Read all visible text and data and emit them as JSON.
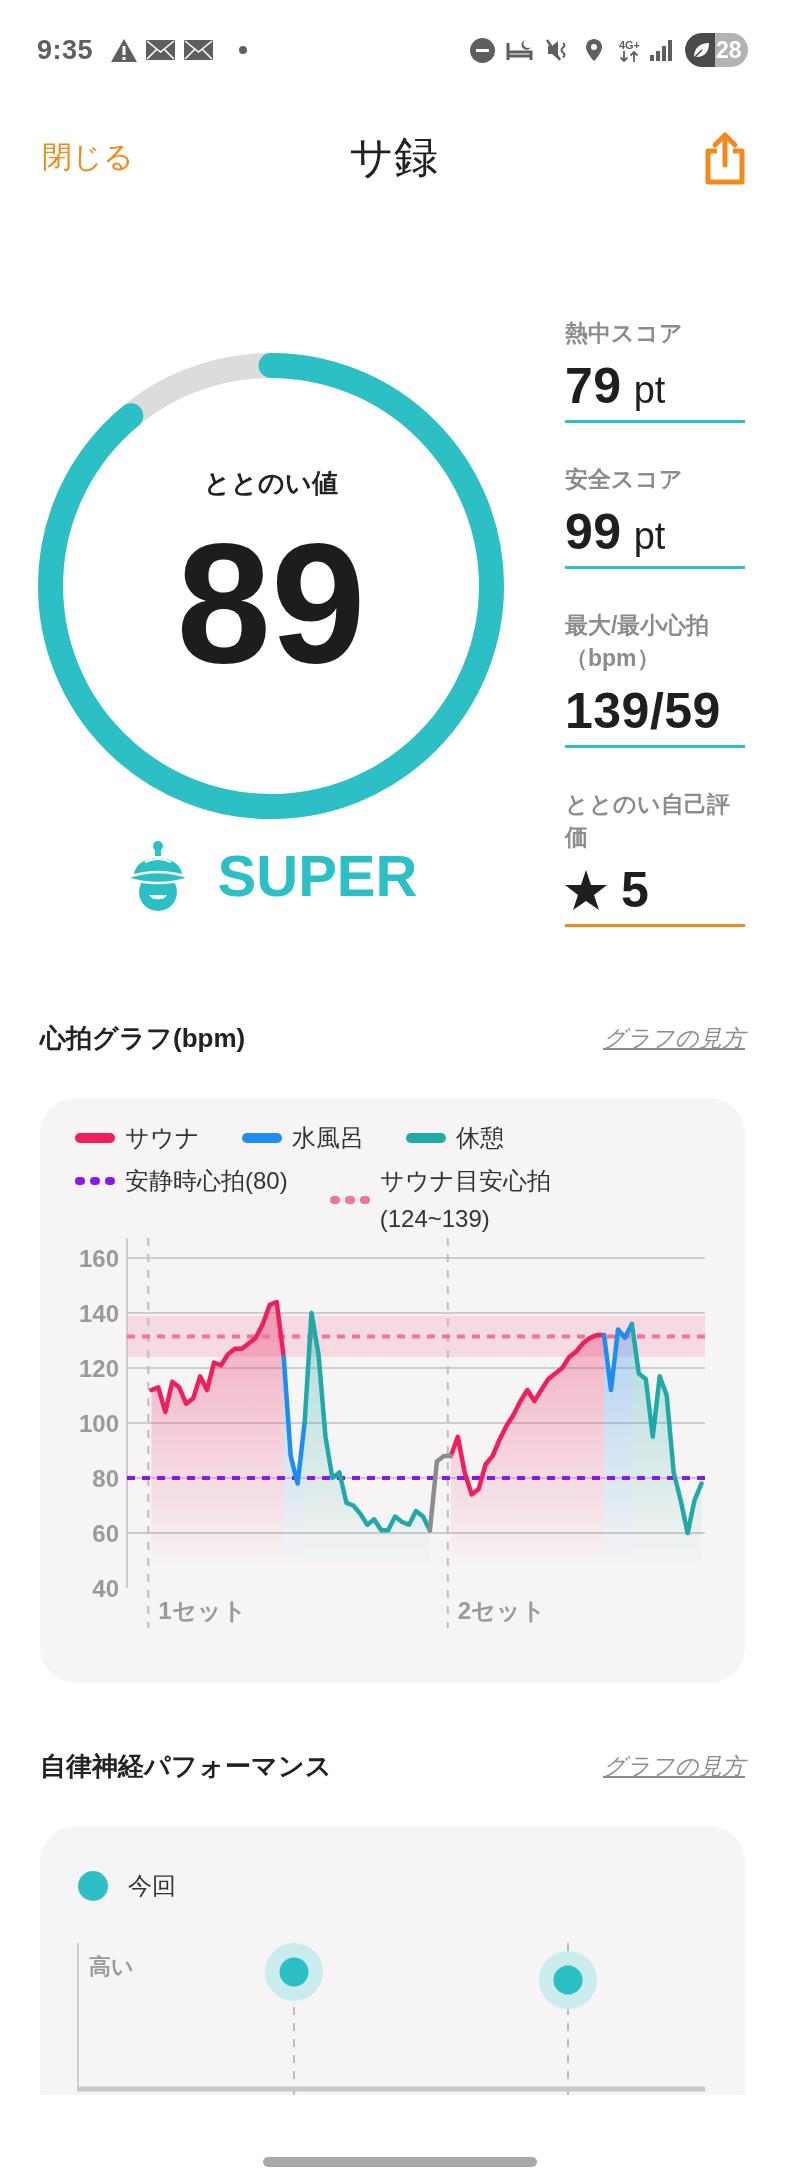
{
  "status_bar": {
    "time": "9:35",
    "network": "4G+",
    "battery": "28"
  },
  "header": {
    "close": "閉じる",
    "title": "サ録"
  },
  "ring": {
    "label": "ととのい値",
    "value": "89",
    "level": 0.89
  },
  "rank": {
    "label": "SUPER"
  },
  "scores": [
    {
      "kind": "score",
      "label": "熱中スコア",
      "value": "79",
      "unit": "pt"
    },
    {
      "kind": "score",
      "label": "安全スコア",
      "value": "99",
      "unit": "pt"
    },
    {
      "kind": "score",
      "label": "最大/最小心拍（bpm）",
      "value": "139/59"
    },
    {
      "kind": "rating",
      "label": "ととのい自己評価",
      "value": "5"
    }
  ],
  "heart_chart": {
    "title": "心拍グラフ(bpm)",
    "help_link": "グラフの見方",
    "set_labels": [
      "1セット",
      "2セット"
    ],
    "chart_data": {
      "type": "area",
      "legend": "top",
      "grid": true,
      "ylim": [
        40,
        160
      ],
      "yticks": [
        40,
        60,
        80,
        100,
        120,
        140,
        160
      ],
      "series": [
        {
          "name": "サウナ",
          "color": "#ee1f5b",
          "values": [
            null,
            null,
            null,
            112,
            113,
            104,
            115,
            113,
            107,
            109,
            117,
            112,
            122,
            121,
            125,
            127,
            127,
            129,
            131,
            136,
            143,
            144,
            124,
            null,
            null,
            null,
            null,
            null,
            null,
            null,
            null,
            null,
            null,
            null,
            null,
            null,
            null,
            null,
            null,
            null,
            null,
            null,
            null,
            null,
            null,
            null,
            88,
            95,
            82,
            74,
            76,
            85,
            88,
            94,
            99,
            103,
            108,
            112,
            108,
            112,
            116,
            118,
            120,
            124,
            126,
            129,
            131,
            132,
            132,
            null,
            null,
            null,
            null,
            null,
            null,
            null,
            null,
            null,
            null,
            null,
            null,
            null,
            null
          ]
        },
        {
          "name": "水風呂",
          "color": "#1e8cf0",
          "values": [
            null,
            null,
            null,
            null,
            null,
            null,
            null,
            null,
            null,
            null,
            null,
            null,
            null,
            null,
            null,
            null,
            null,
            null,
            null,
            null,
            null,
            null,
            124,
            88,
            78,
            100,
            null,
            null,
            null,
            null,
            null,
            null,
            null,
            null,
            null,
            null,
            null,
            null,
            null,
            null,
            null,
            null,
            null,
            null,
            null,
            null,
            null,
            null,
            null,
            null,
            null,
            null,
            null,
            null,
            null,
            null,
            null,
            null,
            null,
            null,
            null,
            null,
            null,
            null,
            null,
            null,
            null,
            null,
            132,
            112,
            134,
            131,
            136,
            null,
            null,
            null,
            null,
            null,
            null,
            null,
            null,
            null,
            null
          ]
        },
        {
          "name": "休憩",
          "color": "#20a9a8",
          "values": [
            null,
            null,
            null,
            null,
            null,
            null,
            null,
            null,
            null,
            null,
            null,
            null,
            null,
            null,
            null,
            null,
            null,
            null,
            null,
            null,
            null,
            null,
            null,
            null,
            null,
            100,
            140,
            125,
            95,
            80,
            82,
            71,
            70,
            67,
            63,
            65,
            61,
            61,
            66,
            64,
            63,
            68,
            66,
            61,
            null,
            null,
            null,
            null,
            null,
            null,
            null,
            null,
            null,
            null,
            null,
            null,
            null,
            null,
            null,
            null,
            null,
            null,
            null,
            null,
            null,
            null,
            null,
            null,
            null,
            null,
            null,
            null,
            136,
            118,
            116,
            95,
            117,
            110,
            82,
            72,
            60,
            72,
            78
          ]
        },
        {
          "type": "line",
          "color": "#8c8c8c",
          "values": [
            null,
            null,
            null,
            null,
            null,
            null,
            null,
            null,
            null,
            null,
            null,
            null,
            null,
            null,
            null,
            null,
            null,
            null,
            null,
            null,
            null,
            null,
            null,
            null,
            null,
            null,
            null,
            null,
            null,
            null,
            null,
            null,
            null,
            null,
            null,
            null,
            null,
            null,
            null,
            null,
            null,
            null,
            null,
            61,
            86,
            88,
            88,
            null,
            null,
            null,
            null,
            null,
            null,
            null,
            null,
            null,
            null,
            null,
            null,
            null,
            null,
            null,
            null,
            null,
            null,
            null,
            null,
            null,
            null,
            null,
            null,
            null,
            null,
            null,
            null,
            null,
            null,
            null,
            null,
            null,
            null,
            null,
            null
          ]
        }
      ],
      "ref_lines": [
        {
          "axis": "y",
          "value": 80,
          "label": "安静時心拍(80)",
          "color": "#8a17ee"
        },
        {
          "axis": "y",
          "value": 131.5,
          "color": "#f3719b"
        }
      ],
      "bands": [
        {
          "axis": "y",
          "from": 124,
          "to": 139,
          "label": "サウナ目安心拍(124~139)",
          "color": "#f3719b"
        }
      ]
    }
  },
  "autonomic": {
    "title": "自律神経パフォーマンス",
    "help_link": "グラフの見方",
    "legend": [
      "今回"
    ],
    "axis_label": "高い"
  }
}
